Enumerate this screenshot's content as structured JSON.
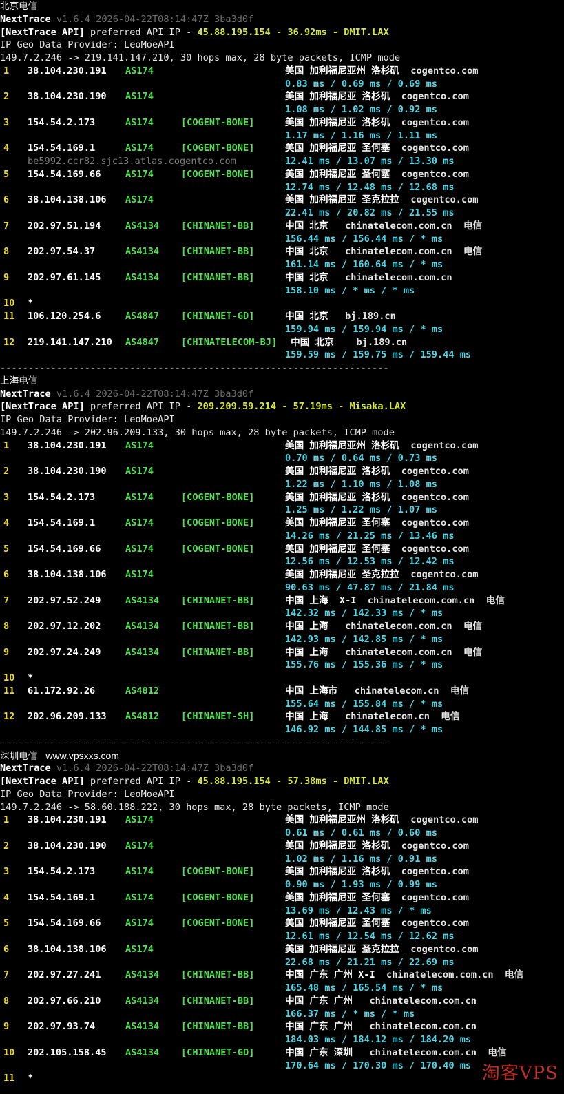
{
  "sections": [
    {
      "title": "北京电信",
      "watermark": "",
      "tool_name": "NextTrace",
      "tool_version": "v1.6.4 2026-04-22T08:14:47Z 3ba3d0f",
      "api_tag": "[NextTrace API]",
      "api_text": "preferred API IP -",
      "api_ip": "45.88.195.154",
      "api_ms": "36.92ms",
      "api_node": "DMIT.LAX",
      "geo_provider": "IP Geo Data Provider: LeoMoeAPI",
      "trace_line": "149.7.2.246 -> 219.141.147.210, 30 hops max, 28 byte packets, ICMP mode",
      "hops": [
        {
          "no": "1",
          "ip": "38.104.230.191",
          "as": "AS174",
          "tag": "",
          "geo": "美国 加利福尼亚州 洛杉矶",
          "domain": "cogentco.com",
          "isp": "",
          "rtt": "0.83 ms / 0.69 ms / 0.69 ms",
          "host": ""
        },
        {
          "no": "2",
          "ip": "38.104.230.190",
          "as": "AS174",
          "tag": "",
          "geo": "美国 加利福尼亚 洛杉矶",
          "domain": "cogentco.com",
          "isp": "",
          "rtt": "1.08 ms / 1.02 ms / 0.92 ms",
          "host": ""
        },
        {
          "no": "3",
          "ip": "154.54.2.173",
          "as": "AS174",
          "tag": "[COGENT-BONE]",
          "geo": "美国 加利福尼亚 洛杉矶",
          "domain": "cogentco.com",
          "isp": "",
          "rtt": "1.17 ms / 1.16 ms / 1.11 ms",
          "host": ""
        },
        {
          "no": "4",
          "ip": "154.54.169.1",
          "as": "AS174",
          "tag": "[COGENT-BONE]",
          "geo": "美国 加利福尼亚 圣何塞",
          "domain": "cogentco.com",
          "isp": "",
          "rtt": "12.41 ms / 13.07 ms / 13.30 ms",
          "host": "be5992.ccr82.sjc13.atlas.cogentco.com"
        },
        {
          "no": "5",
          "ip": "154.54.169.66",
          "as": "AS174",
          "tag": "[COGENT-BONE]",
          "geo": "美国 加利福尼亚 圣何塞",
          "domain": "cogentco.com",
          "isp": "",
          "rtt": "12.74 ms / 12.48 ms / 12.68 ms",
          "host": ""
        },
        {
          "no": "6",
          "ip": "38.104.138.106",
          "as": "AS174",
          "tag": "",
          "geo": "美国 加利福尼亚 圣克拉拉",
          "domain": "cogentco.com",
          "isp": "",
          "rtt": "22.41 ms / 20.82 ms / 21.55 ms",
          "host": ""
        },
        {
          "no": "7",
          "ip": "202.97.51.194",
          "as": "AS4134",
          "tag": "[CHINANET-BB]",
          "geo": "中国 北京",
          "domain": " chinatelecom.com.cn",
          "isp": "电信",
          "rtt": "156.44 ms / 156.44 ms / * ms",
          "host": ""
        },
        {
          "no": "8",
          "ip": "202.97.54.37",
          "as": "AS4134",
          "tag": "[CHINANET-BB]",
          "geo": "中国 北京",
          "domain": " chinatelecom.com.cn",
          "isp": "电信",
          "rtt": "161.14 ms / 160.64 ms / * ms",
          "host": ""
        },
        {
          "no": "9",
          "ip": "202.97.61.145",
          "as": "AS4134",
          "tag": "[CHINANET-BB]",
          "geo": "中国 北京",
          "domain": " chinatelecom.com.cn",
          "isp": "",
          "rtt": "158.10 ms / * ms / * ms",
          "host": ""
        },
        {
          "no": "10",
          "ip": "*",
          "as": "",
          "tag": "",
          "geo": "",
          "domain": "",
          "isp": "",
          "rtt": "",
          "host": ""
        },
        {
          "no": "11",
          "ip": "106.120.254.6",
          "as": "AS4847",
          "tag": "[CHINANET-GD]",
          "geo": "中国 北京",
          "domain": " bj.189.cn",
          "isp": "",
          "rtt": "159.94 ms / 159.94 ms / * ms",
          "host": ""
        },
        {
          "no": "12",
          "ip": "219.141.147.210",
          "as": "AS4847",
          "tag": "[CHINATELECOM-BJ]",
          "geo": " 中国 北京",
          "domain": "  bj.189.cn",
          "isp": "",
          "rtt": "159.59 ms / 159.75 ms / 159.44 ms",
          "host": ""
        }
      ]
    },
    {
      "title": "上海电信",
      "watermark": "",
      "tool_name": "NextTrace",
      "tool_version": "v1.6.4 2026-04-22T08:14:47Z 3ba3d0f",
      "api_tag": "[NextTrace API]",
      "api_text": "preferred API IP -",
      "api_ip": "209.209.59.214",
      "api_ms": "57.19ms",
      "api_node": "Misaka.LAX",
      "geo_provider": "IP Geo Data Provider: LeoMoeAPI",
      "trace_line": "149.7.2.246 -> 202.96.209.133, 30 hops max, 28 byte packets, ICMP mode",
      "hops": [
        {
          "no": "1",
          "ip": "38.104.230.191",
          "as": "AS174",
          "tag": "",
          "geo": "美国 加利福尼亚州 洛杉矶",
          "domain": "cogentco.com",
          "isp": "",
          "rtt": "0.70 ms / 0.64 ms / 0.73 ms",
          "host": ""
        },
        {
          "no": "2",
          "ip": "38.104.230.190",
          "as": "AS174",
          "tag": "",
          "geo": "美国 加利福尼亚 洛杉矶",
          "domain": "cogentco.com",
          "isp": "",
          "rtt": "1.22 ms / 1.10 ms / 1.08 ms",
          "host": ""
        },
        {
          "no": "3",
          "ip": "154.54.2.173",
          "as": "AS174",
          "tag": "[COGENT-BONE]",
          "geo": "美国 加利福尼亚 洛杉矶",
          "domain": "cogentco.com",
          "isp": "",
          "rtt": "1.25 ms / 1.22 ms / 1.07 ms",
          "host": ""
        },
        {
          "no": "4",
          "ip": "154.54.169.1",
          "as": "AS174",
          "tag": "[COGENT-BONE]",
          "geo": "美国 加利福尼亚 圣何塞",
          "domain": "cogentco.com",
          "isp": "",
          "rtt": "14.26 ms / 21.25 ms / 13.46 ms",
          "host": ""
        },
        {
          "no": "5",
          "ip": "154.54.169.66",
          "as": "AS174",
          "tag": "[COGENT-BONE]",
          "geo": "美国 加利福尼亚 圣何塞",
          "domain": "cogentco.com",
          "isp": "",
          "rtt": "12.56 ms / 12.53 ms / 12.42 ms",
          "host": ""
        },
        {
          "no": "6",
          "ip": "38.104.138.106",
          "as": "AS174",
          "tag": "",
          "geo": "美国 加利福尼亚 圣克拉拉",
          "domain": "cogentco.com",
          "isp": "",
          "rtt": "90.63 ms / 47.87 ms / 21.84 ms",
          "host": ""
        },
        {
          "no": "7",
          "ip": "202.97.52.249",
          "as": "AS4134",
          "tag": "[CHINANET-BB]",
          "geo": "中国 上海  X-I",
          "domain": "chinatelecom.com.cn",
          "isp": "电信",
          "rtt": "142.32 ms / 142.33 ms / * ms",
          "host": ""
        },
        {
          "no": "8",
          "ip": "202.97.12.202",
          "as": "AS4134",
          "tag": "[CHINANET-BB]",
          "geo": "中国 上海",
          "domain": " chinatelecom.com.cn",
          "isp": "电信",
          "rtt": "142.93 ms / 142.85 ms / * ms",
          "host": ""
        },
        {
          "no": "9",
          "ip": "202.97.24.249",
          "as": "AS4134",
          "tag": "[CHINANET-BB]",
          "geo": "中国 上海",
          "domain": " chinatelecom.com.cn",
          "isp": "电信",
          "rtt": "155.76 ms / 155.36 ms / * ms",
          "host": ""
        },
        {
          "no": "10",
          "ip": "*",
          "as": "",
          "tag": "",
          "geo": "",
          "domain": "",
          "isp": "",
          "rtt": "",
          "host": ""
        },
        {
          "no": "11",
          "ip": "61.172.92.26",
          "as": "AS4812",
          "tag": "",
          "geo": "中国 上海市",
          "domain": " chinatelecom.cn",
          "isp": "电信",
          "rtt": "155.64 ms / 155.84 ms / * ms",
          "host": ""
        },
        {
          "no": "12",
          "ip": "202.96.209.133",
          "as": "AS4812",
          "tag": "[CHINANET-SH]",
          "geo": "中国 上海",
          "domain": " chinatelecom.cn",
          "isp": "电信",
          "rtt": "146.92 ms / 144.85 ms / * ms",
          "host": ""
        }
      ]
    },
    {
      "title": "深圳电信",
      "watermark": "www.vpsxxs.com",
      "tool_name": "NextTrace",
      "tool_version": "v1.6.4 2026-04-22T08:14:47Z 3ba3d0f",
      "api_tag": "[NextTrace API]",
      "api_text": "preferred API IP -",
      "api_ip": "45.88.195.154",
      "api_ms": "57.38ms",
      "api_node": "DMIT.LAX",
      "geo_provider": "IP Geo Data Provider: LeoMoeAPI",
      "trace_line": "149.7.2.246 -> 58.60.188.222, 30 hops max, 28 byte packets, ICMP mode",
      "hops": [
        {
          "no": "1",
          "ip": "38.104.230.191",
          "as": "AS174",
          "tag": "",
          "geo": "美国 加利福尼亚州 洛杉矶",
          "domain": "cogentco.com",
          "isp": "",
          "rtt": "0.61 ms / 0.61 ms / 0.60 ms",
          "host": ""
        },
        {
          "no": "2",
          "ip": "38.104.230.190",
          "as": "AS174",
          "tag": "",
          "geo": "美国 加利福尼亚 洛杉矶",
          "domain": "cogentco.com",
          "isp": "",
          "rtt": "1.02 ms / 1.16 ms / 0.91 ms",
          "host": ""
        },
        {
          "no": "3",
          "ip": "154.54.2.173",
          "as": "AS174",
          "tag": "[COGENT-BONE]",
          "geo": "美国 加利福尼亚 洛杉矶",
          "domain": "cogentco.com",
          "isp": "",
          "rtt": "0.90 ms / 1.93 ms / 0.99 ms",
          "host": ""
        },
        {
          "no": "4",
          "ip": "154.54.169.1",
          "as": "AS174",
          "tag": "[COGENT-BONE]",
          "geo": "美国 加利福尼亚 圣何塞",
          "domain": "cogentco.com",
          "isp": "",
          "rtt": "13.69 ms / 12.43 ms / * ms",
          "host": ""
        },
        {
          "no": "5",
          "ip": "154.54.169.66",
          "as": "AS174",
          "tag": "[COGENT-BONE]",
          "geo": "美国 加利福尼亚 圣何塞",
          "domain": "cogentco.com",
          "isp": "",
          "rtt": "12.61 ms / 12.54 ms / 12.62 ms",
          "host": ""
        },
        {
          "no": "6",
          "ip": "38.104.138.106",
          "as": "AS174",
          "tag": "",
          "geo": "美国 加利福尼亚 圣克拉拉",
          "domain": "cogentco.com",
          "isp": "",
          "rtt": "22.68 ms / 21.21 ms / 22.69 ms",
          "host": ""
        },
        {
          "no": "7",
          "ip": "202.97.27.241",
          "as": "AS4134",
          "tag": "[CHINANET-BB]",
          "geo": "中国 广东 广州 X-I",
          "domain": "chinatelecom.com.cn",
          "isp": "电信",
          "rtt": "165.48 ms / 165.54 ms / * ms",
          "host": ""
        },
        {
          "no": "8",
          "ip": "202.97.66.210",
          "as": "AS4134",
          "tag": "[CHINANET-BB]",
          "geo": "中国 广东 广州",
          "domain": " chinatelecom.com.cn",
          "isp": "",
          "rtt": "166.37 ms / * ms / * ms",
          "host": ""
        },
        {
          "no": "9",
          "ip": "202.97.93.74",
          "as": "AS4134",
          "tag": "[CHINANET-BB]",
          "geo": "中国 广东 广州",
          "domain": " chinatelecom.com.cn",
          "isp": "",
          "rtt": "184.03 ms / 184.12 ms / 184.20 ms",
          "host": ""
        },
        {
          "no": "10",
          "ip": "202.105.158.45",
          "as": "AS4134",
          "tag": "[CHINANET-GD]",
          "geo": "中国 广东 深圳",
          "domain": " chinatelecom.com.cn",
          "isp": "电信",
          "rtt": "170.64 ms / 170.30 ms / 170.40 ms",
          "host": ""
        },
        {
          "no": "11",
          "ip": "*",
          "as": "",
          "tag": "",
          "geo": "",
          "domain": "",
          "isp": "",
          "rtt": "",
          "host": ""
        }
      ]
    }
  ],
  "separator": "---------------------------------------------------------------------",
  "stamp_text": "淘客VPS"
}
